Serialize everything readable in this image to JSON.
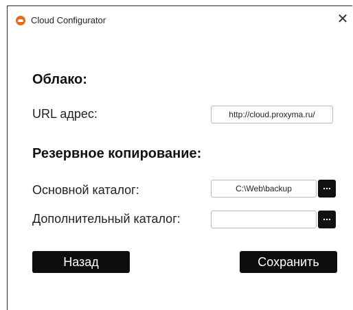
{
  "window": {
    "title": "Cloud Configurator",
    "close_glyph": "✕",
    "app_icon": "cloud-logo-icon",
    "accent": "#e8691b"
  },
  "cloud": {
    "heading": "Облако:",
    "url_label": "URL адрес:",
    "url_value": "http://cloud.proxyma.ru/"
  },
  "backup": {
    "heading": "Резервное копирование:",
    "primary_label": "Основной каталог:",
    "primary_value": "C:\\Web\\backup",
    "secondary_label": "Дополнительный каталог:",
    "secondary_value": "",
    "browse_label": "..."
  },
  "actions": {
    "back_label": "Назад",
    "save_label": "Сохранить"
  }
}
